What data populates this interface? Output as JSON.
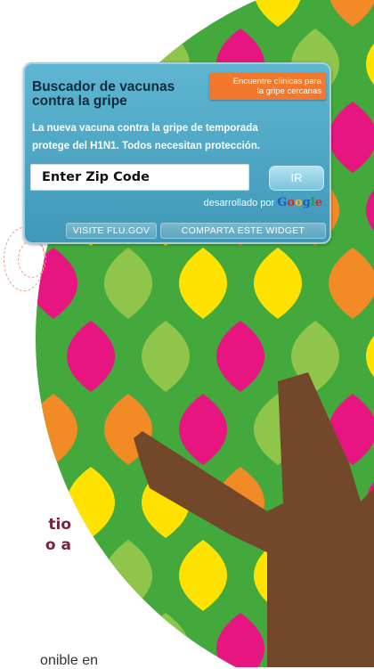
{
  "colors": {
    "background_green": "#43a93c",
    "leaf_magenta": "#e6157f",
    "leaf_orange": "#f28a25",
    "leaf_yellow": "#ffe200",
    "leaf_lightgreen": "#8ec54a",
    "trunk_brown": "#72472a",
    "widget_blue": "#4aa6c5",
    "tagline_orange": "#f4782b",
    "side_text": "#7a1f43"
  },
  "widget": {
    "title_line1": "Buscador de vacunas",
    "title_line2": "contra la gripe",
    "tagline_line1": "Encuentre clínicas para",
    "tagline_line2": "la gripe cercanas",
    "description_line1": "La nueva vacuna contra la gripe de temporada",
    "description_line2": "protege del H1N1. Todos necesitan protección.",
    "zip_placeholder": "Enter Zip Code",
    "go_label": "IR",
    "powered_by": "desarrollado por",
    "google": {
      "G": "G",
      "o1": "o",
      "o2": "o",
      "g": "g",
      "l": "l",
      "e": "e"
    },
    "visit_label": "VISITE FLU.GOV",
    "share_label": "COMPARTA ESTE WIDGET"
  },
  "side_text": {
    "line1": "tio",
    "line2": "o a"
  },
  "bottom_text": "onible en"
}
